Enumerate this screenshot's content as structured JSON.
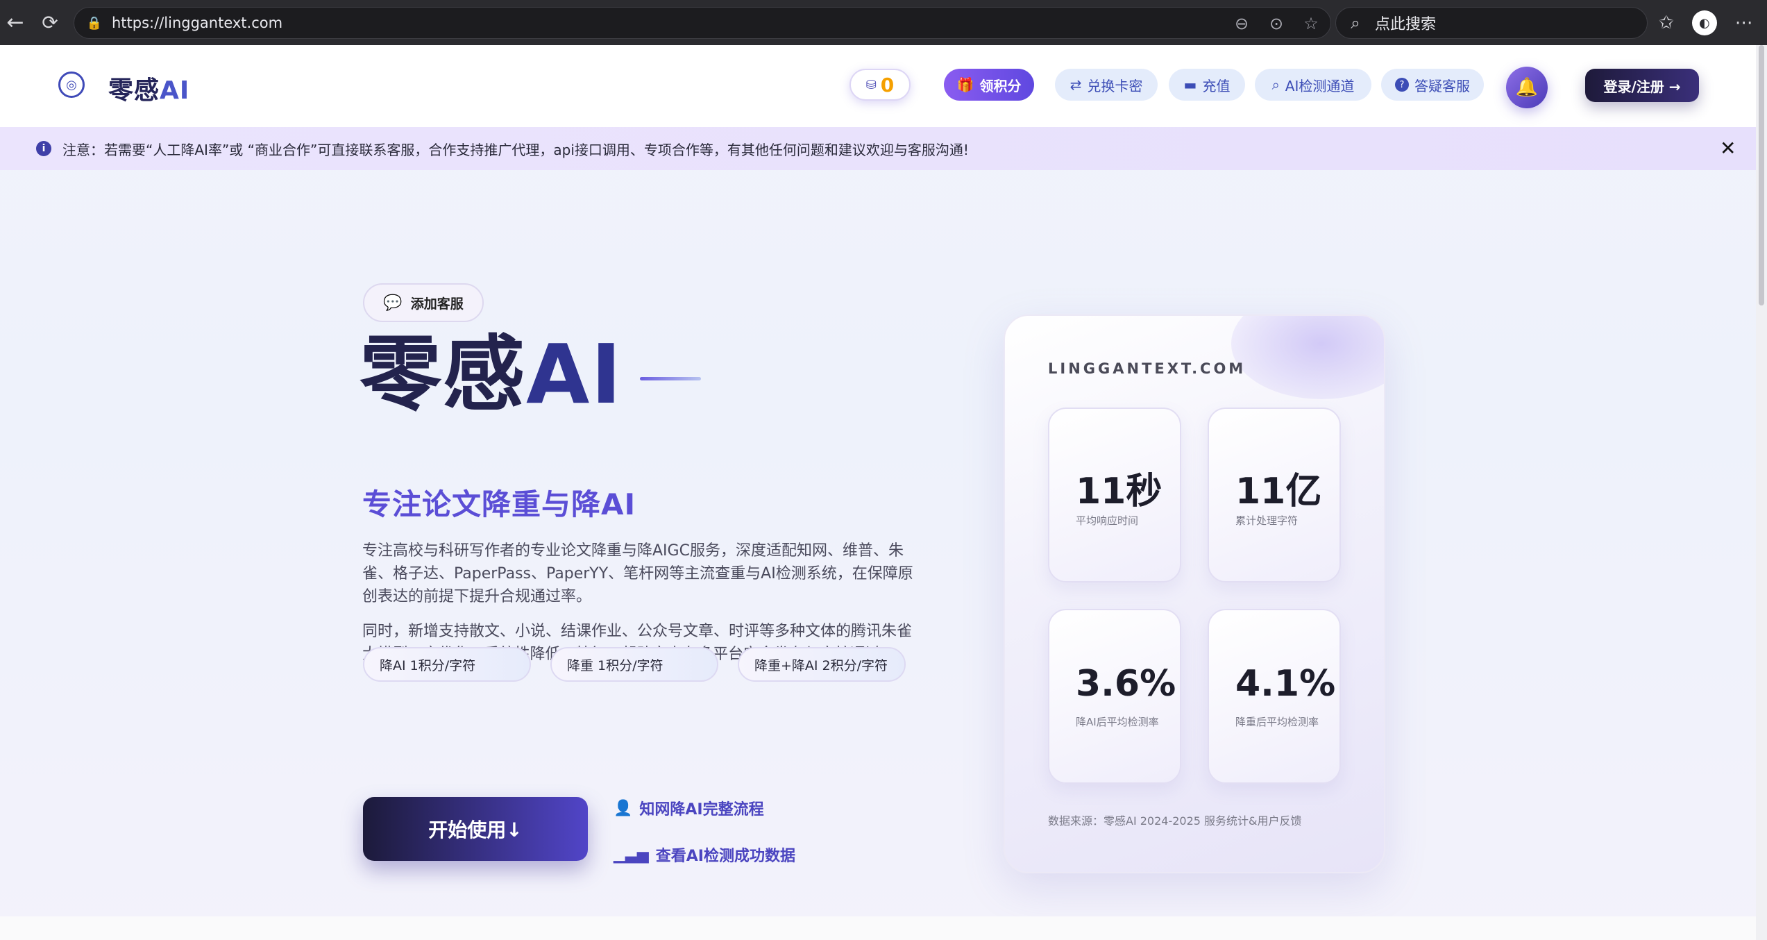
{
  "browser": {
    "url": "https://linggantext.com",
    "search_placeholder": "点此搜索",
    "back_icon": "←",
    "reload_icon": "⟳"
  },
  "header": {
    "logo_text": "零感",
    "logo_ai": "AI",
    "coins_value": "0",
    "get_points": "领积分",
    "nav": [
      {
        "label": "兑换卡密",
        "icon": "⇄"
      },
      {
        "label": "充值",
        "icon": "▬"
      },
      {
        "label": "AI检测通道",
        "icon": "⌕"
      },
      {
        "label": "答疑客服",
        "icon": "?"
      }
    ],
    "login": "登录/注册 →"
  },
  "notice": {
    "text": "注意：若需要“人工降AI率”或 “商业合作”可直接联系客服，合作支持推广代理，api接口调用、专项合作等，有其他任何问题和建议欢迎与客服沟通!",
    "close": "✕"
  },
  "hero": {
    "wechat_label": "添加客服",
    "title_main": "零感",
    "title_ai": "AI",
    "subtitle": "专注论文降重与降AI",
    "desc1": "专注高校与科研写作者的专业论文降重与降AIGC服务，深度适配知网、维普、朱雀、格子达、PaperPass、PaperYY、笔杆网等主流查重与AI检测系统，在保障原创表达的前提下提升合规通过率。",
    "desc2": "同时，新增支持散文、小说、结课作业、公众号文章、时评等多种文体的腾讯朱雀大模型AI率优化，系统性降低AI特征，帮助文本在多平台安全发布与审核通过。",
    "rates": [
      "降AI 1积分/字符",
      "降重 1积分/字符",
      "降重+降AI 2积分/字符"
    ],
    "start_button": "开始使用↓",
    "link1": "知网降AI完整流程",
    "link2": "查看AI检测成功数据"
  },
  "stats_card": {
    "domain": "LINGGANTEXT.COM",
    "stats": [
      {
        "value": "11秒",
        "label": "平均响应时间"
      },
      {
        "value": "11亿",
        "label": "累计处理字符"
      },
      {
        "value": "3.6%",
        "label": "降AI后平均检测率"
      },
      {
        "value": "4.1%",
        "label": "降重后平均检测率"
      }
    ],
    "source": "数据来源：零感AI 2024-2025 服务统计&用户反馈"
  }
}
